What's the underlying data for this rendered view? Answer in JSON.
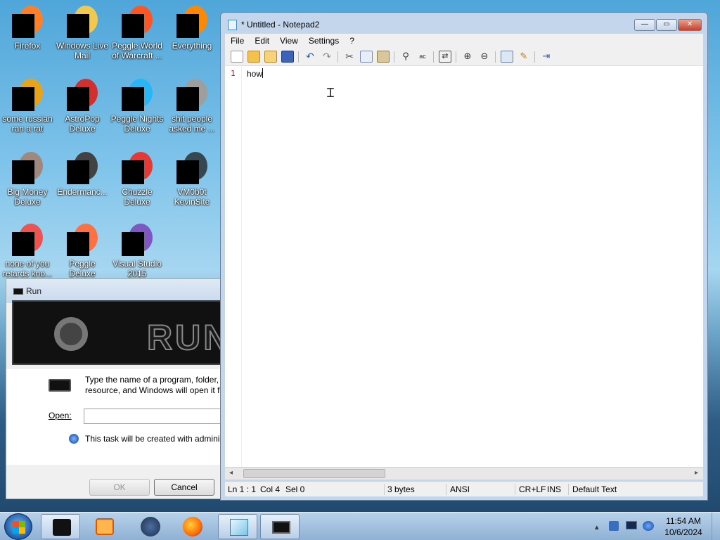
{
  "desktop": {
    "icons": [
      {
        "label": "Firefox",
        "color": "#ff7f27"
      },
      {
        "label": "Windows Live Mail",
        "color": "#f2c94c"
      },
      {
        "label": "Peggle World of Warcraft ...",
        "color": "#ff5522"
      },
      {
        "label": "Everything",
        "color": "#ff8800"
      },
      {
        "label": "some russian ran a rat",
        "color": "#e8a317"
      },
      {
        "label": "AstroPop Deluxe",
        "color": "#d32f2f"
      },
      {
        "label": "Peggle Nights Deluxe",
        "color": "#29b6f6"
      },
      {
        "label": "shit people asked me ...",
        "color": "#9e9e9e"
      },
      {
        "label": "Big Money Deluxe",
        "color": "#a1887f"
      },
      {
        "label": "Endermanc...",
        "color": "#424242"
      },
      {
        "label": "Chuzzle Deluxe",
        "color": "#e53935"
      },
      {
        "label": "VM0b0t KevinSite",
        "color": "#37474f"
      },
      {
        "label": "none of you retards kno...",
        "color": "#ef5350"
      },
      {
        "label": "Peggle Deluxe",
        "color": "#ff7043"
      },
      {
        "label": "Visual Studio 2015",
        "color": "#7e57c2"
      }
    ]
  },
  "run_dialog": {
    "title": "Run",
    "banner_text": "RUN",
    "description_line1": "Type the name of a program, folder,",
    "description_line2": "resource, and Windows will open it f",
    "open_label": "Open:",
    "open_value": "",
    "admin_note": "This task will be created with admini",
    "ok_label": "OK",
    "cancel_label": "Cancel"
  },
  "notepad": {
    "title": "* Untitled - Notepad2",
    "window_buttons": {
      "minimize": "—",
      "maximize": "▭",
      "close": "✕"
    },
    "menu": [
      "File",
      "Edit",
      "View",
      "Settings",
      "?"
    ],
    "toolbar_icons": [
      "new-icon",
      "open-icon",
      "browse-icon",
      "save-icon",
      "undo-icon",
      "redo-icon",
      "cut-icon",
      "copy-icon",
      "paste-icon",
      "find-icon",
      "replace-icon",
      "wordwrap-icon",
      "zoom-in-icon",
      "zoom-out-icon",
      "view-icon",
      "edit-icon",
      "exit-icon"
    ],
    "line_number": "1",
    "content": "how",
    "status": {
      "position": "Ln 1 : 1",
      "col": "Col 4",
      "sel": "Sel 0",
      "size": "3 bytes",
      "encoding": "ANSI",
      "eol": "CR+LF",
      "mode": "INS",
      "lexer": "Default Text"
    }
  },
  "taskbar": {
    "items": [
      "cmd",
      "media",
      "app-globe",
      "firefox",
      "notepad2",
      "run"
    ],
    "clock_time": "11:54 AM",
    "clock_date": "10/6/2024"
  }
}
